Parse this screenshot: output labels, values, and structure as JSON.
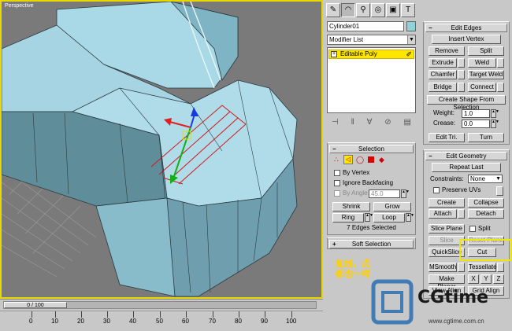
{
  "viewport": {
    "label": "Perspective",
    "note_line1": "加线，点",
    "note_line2": "都也一样"
  },
  "timeline": {
    "frame_display": "0 / 100",
    "ticks": [
      "0",
      "10",
      "20",
      "30",
      "40",
      "50",
      "60",
      "70",
      "80",
      "90",
      "100"
    ]
  },
  "command_tabs": [
    "create-tab",
    "modify-tab",
    "hierarchy-tab",
    "motion-tab",
    "display-tab",
    "utilities-tab"
  ],
  "object": {
    "name": "Cylinder01",
    "color": "#8fd3d8"
  },
  "modifier_list": {
    "selected": "Modifier List"
  },
  "stack": {
    "item": "Editable Poly"
  },
  "selection": {
    "title": "Selection",
    "by_vertex": "By Vertex",
    "ignore_backfacing": "Ignore Backfacing",
    "by_angle": "By Angle:",
    "angle_value": "45.0",
    "shrink": "Shrink",
    "grow": "Grow",
    "ring": "Ring",
    "loop": "Loop",
    "status": "7 Edges Selected"
  },
  "soft_selection": {
    "title": "Soft Selection"
  },
  "edit_edges": {
    "title": "Edit Edges",
    "insert_vertex": "Insert Vertex",
    "remove": "Remove",
    "split": "Split",
    "extrude": "Extrude",
    "weld": "Weld",
    "chamfer": "Chamfer",
    "target_weld": "Target Weld",
    "bridge": "Bridge",
    "connect": "Connect",
    "create_shape": "Create Shape From Selection",
    "weight_label": "Weight:",
    "weight_value": "1.0",
    "crease_label": "Crease:",
    "crease_value": "0.0",
    "edit_tri": "Edit Tri.",
    "turn": "Turn"
  },
  "edit_geometry": {
    "title": "Edit Geometry",
    "repeat_last": "Repeat Last",
    "constraints_label": "Constraints:",
    "constraints_value": "None",
    "preserve_uvs": "Preserve UVs",
    "create": "Create",
    "collapse": "Collapse",
    "attach": "Attach",
    "detach": "Detach",
    "slice_plane": "Slice Plane",
    "split": "Split",
    "slice": "Slice",
    "reset_plane": "Reset Plane",
    "quickslice": "QuickSlice",
    "cut": "Cut",
    "msmooth": "MSmooth",
    "tessellate": "Tessellate",
    "make_planar": "Make Planar",
    "x": "X",
    "y": "Y",
    "z": "Z",
    "view_align": "View Align",
    "grid_align": "Grid Align"
  },
  "logo": {
    "brand": "CGtime",
    "url": "www.cgtime.com.cn"
  }
}
